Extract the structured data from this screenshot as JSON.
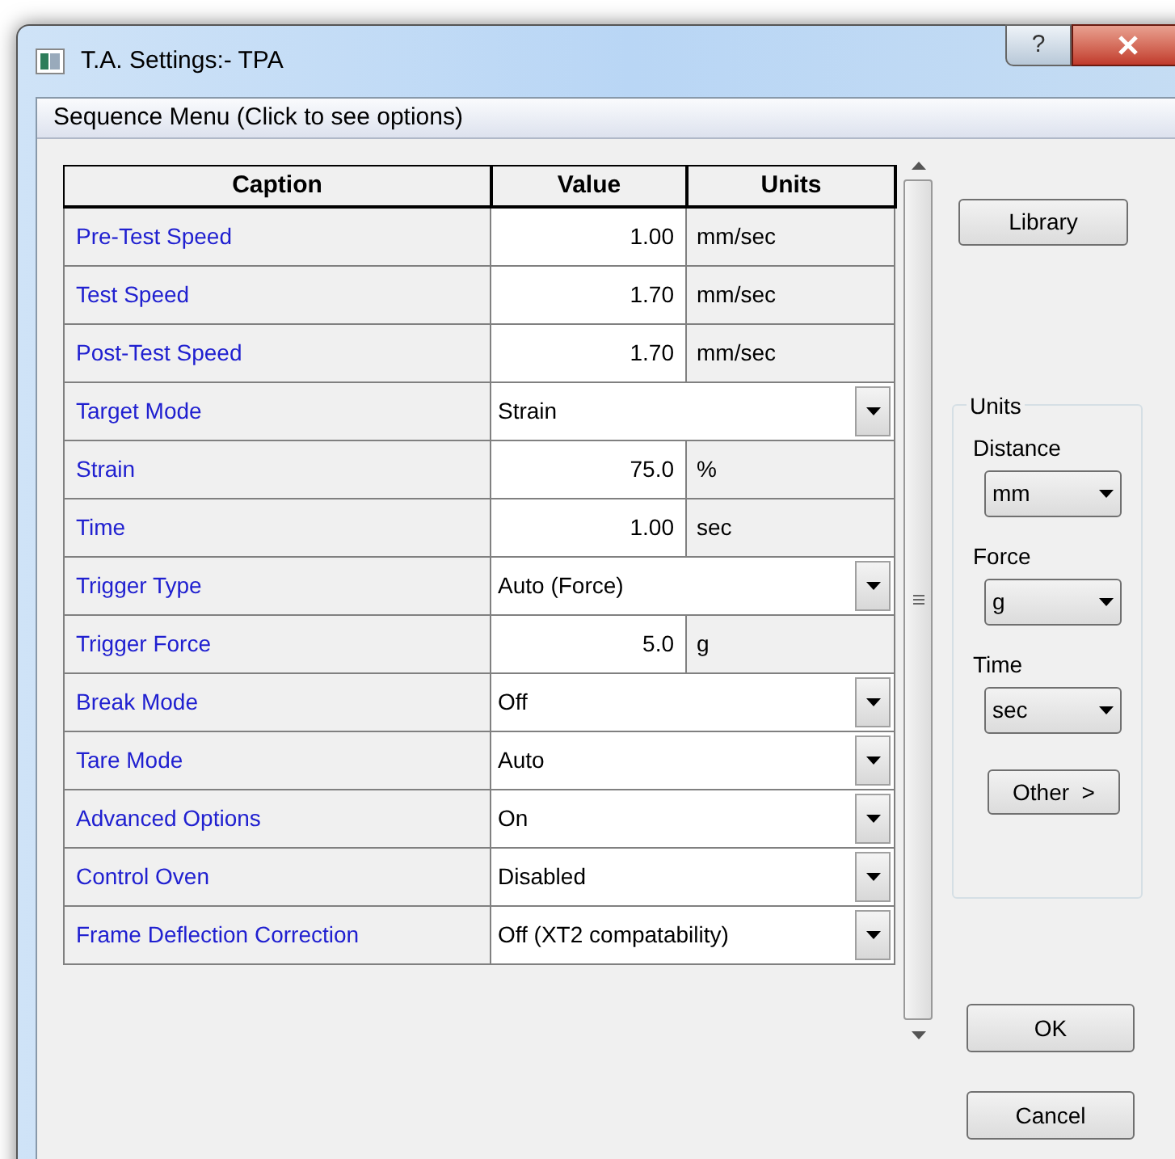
{
  "window": {
    "title": "T.A. Settings:- TPA",
    "help_button": "?"
  },
  "menu_bar": {
    "label": "Sequence Menu (Click to see options)"
  },
  "table": {
    "columns": [
      "Caption",
      "Value",
      "Units"
    ],
    "rows": [
      {
        "kind": "number",
        "caption": "Pre-Test Speed",
        "value": "1.00",
        "units": "mm/sec"
      },
      {
        "kind": "number",
        "caption": "Test Speed",
        "value": "1.70",
        "units": "mm/sec"
      },
      {
        "kind": "number",
        "caption": "Post-Test Speed",
        "value": "1.70",
        "units": "mm/sec"
      },
      {
        "kind": "dropdown",
        "caption": "Target Mode",
        "value": "Strain"
      },
      {
        "kind": "number",
        "caption": "Strain",
        "value": "75.0",
        "units": "%"
      },
      {
        "kind": "number",
        "caption": "Time",
        "value": "1.00",
        "units": "sec"
      },
      {
        "kind": "dropdown",
        "caption": "Trigger Type",
        "value": "Auto (Force)"
      },
      {
        "kind": "number",
        "caption": "Trigger Force",
        "value": "5.0",
        "units": "g"
      },
      {
        "kind": "dropdown",
        "caption": "Break Mode",
        "value": "Off"
      },
      {
        "kind": "dropdown",
        "caption": "Tare Mode",
        "value": "Auto"
      },
      {
        "kind": "dropdown",
        "caption": "Advanced Options",
        "value": "On"
      },
      {
        "kind": "dropdown",
        "caption": "Control Oven",
        "value": "Disabled"
      },
      {
        "kind": "dropdown",
        "caption": "Frame Deflection Correction",
        "value": "Off (XT2 compatability)"
      }
    ]
  },
  "library_button": "Library",
  "units_group": {
    "title": "Units",
    "fields": [
      {
        "label": "Distance",
        "value": "mm"
      },
      {
        "label": "Force",
        "value": "g"
      },
      {
        "label": "Time",
        "value": "sec"
      }
    ],
    "other_button": "Other  >"
  },
  "buttons": [
    "OK",
    "Cancel"
  ]
}
